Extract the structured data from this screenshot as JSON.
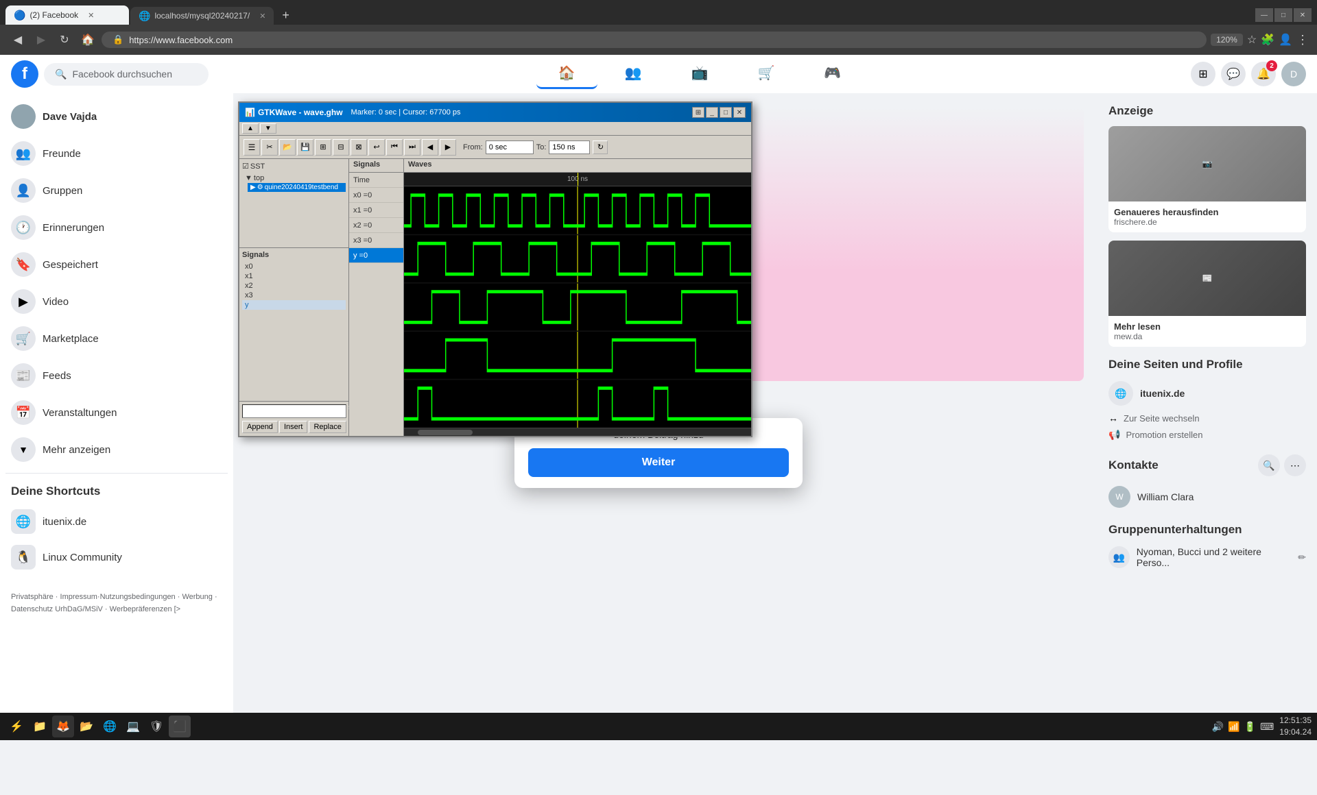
{
  "browser": {
    "tabs": [
      {
        "id": "tab1",
        "label": "(2) Facebook",
        "favicon": "🔵",
        "active": true,
        "url": "https://www.facebook.com"
      },
      {
        "id": "tab2",
        "label": "localhost/mysql20240217/",
        "favicon": "🌐",
        "active": false
      }
    ],
    "address": "https://www.facebook.com",
    "zoom": "120%"
  },
  "facebook": {
    "header": {
      "search_placeholder": "Facebook durchsuchen",
      "user_avatar": "D"
    },
    "sidebar_left": {
      "user_name": "Dave Vajda",
      "items": [
        {
          "id": "freunde",
          "label": "Freunde",
          "icon": "👥"
        },
        {
          "id": "gruppen",
          "label": "Gruppen",
          "icon": "👤"
        },
        {
          "id": "erinnerungen",
          "label": "Erinnerungen",
          "icon": "🕐"
        },
        {
          "id": "gespeichert",
          "label": "Gespeichert",
          "icon": "🔖"
        },
        {
          "id": "video",
          "label": "Video",
          "icon": "▶"
        },
        {
          "id": "marketplace",
          "label": "Marketplace",
          "icon": "🛒"
        },
        {
          "id": "feeds",
          "label": "Feeds",
          "icon": "📰"
        },
        {
          "id": "veranstaltungen",
          "label": "Veranstaltungen",
          "icon": "📅"
        },
        {
          "id": "mehr",
          "label": "Mehr anzeigen",
          "icon": "▼"
        }
      ],
      "shortcuts_title": "Deine Shortcuts",
      "shortcuts": [
        {
          "label": "ituenix.de",
          "icon": "🌐"
        },
        {
          "label": "Linux Community",
          "icon": "🐧"
        }
      ],
      "footer": "Privatsphäre · Impressum·Nutzungsbedingungen · Werbung · Datenschutz\nUrhDaG/MSiV · Werbepräferenzen [>"
    },
    "right_sidebar": {
      "anzeige_title": "Anzeige",
      "ad_text": "Genaueres herausfinden",
      "ad_source": "frischere.de",
      "ad2_text": "Mehr lesen",
      "ad2_source": "mew.da",
      "pages_title": "Deine Seiten und Profile",
      "pages": [
        {
          "name": "ituenix.de",
          "icon": "🌐"
        }
      ],
      "page_actions": [
        {
          "label": "Zur Seite wechseln"
        },
        {
          "label": "Promotion erstellen"
        }
      ],
      "contacts_title": "Kontakte",
      "contacts": [
        {
          "name": "William Clara",
          "initials": "W"
        }
      ],
      "group_chats_title": "Gruppenunterhaltungen",
      "group_chats": [
        {
          "name": "Nyoman, Bucci und 2 weitere Perso...",
          "icon": "👥"
        }
      ]
    }
  },
  "gtkwave": {
    "title": "GTKWave - wave.ghw",
    "subtitle": "Marker: 0 sec  |  Cursor: 67700 ps",
    "toolbar_buttons": [
      "☰",
      "✂",
      "📂",
      "💾",
      "⊞",
      "⊟",
      "⊠",
      "↩",
      "⏮",
      "⏭",
      "◀",
      "▶"
    ],
    "from_label": "From:",
    "from_value": "0 sec",
    "to_label": "To:",
    "to_value": "150 ns",
    "sst": {
      "header": "SST",
      "tree": [
        {
          "label": "top",
          "expanded": true,
          "indent": 0
        },
        {
          "label": "quine20240419testbend",
          "indent": 1,
          "selected": true
        }
      ]
    },
    "signals_list": {
      "title": "Signals",
      "items": [
        "x0",
        "x1",
        "x2",
        "x3",
        "y"
      ]
    },
    "wave_signals": [
      {
        "name": "Time",
        "value": ""
      },
      {
        "name": "x0 =0",
        "value": ""
      },
      {
        "name": "x1 =0",
        "value": ""
      },
      {
        "name": "x2 =0",
        "value": ""
      },
      {
        "name": "x3 =0",
        "value": ""
      },
      {
        "name": "y =0",
        "value": "",
        "selected": true
      }
    ],
    "time_ruler": "100 ns",
    "bottom_buttons": [
      "Append",
      "Insert",
      "Replace"
    ],
    "search_placeholder": ""
  },
  "fb_dialog": {
    "text": "deinem Beitrag hinzu",
    "button_label": "Weiter"
  },
  "taskbar": {
    "icons": [
      "⚡",
      "📁",
      "🦊",
      "📂",
      "🌐",
      "💻",
      "🛡",
      "⬛"
    ],
    "time": "12:51:35",
    "date": "19:04.24",
    "sys_icons": [
      "🔊",
      "📶",
      "🔋",
      "⌨"
    ]
  }
}
